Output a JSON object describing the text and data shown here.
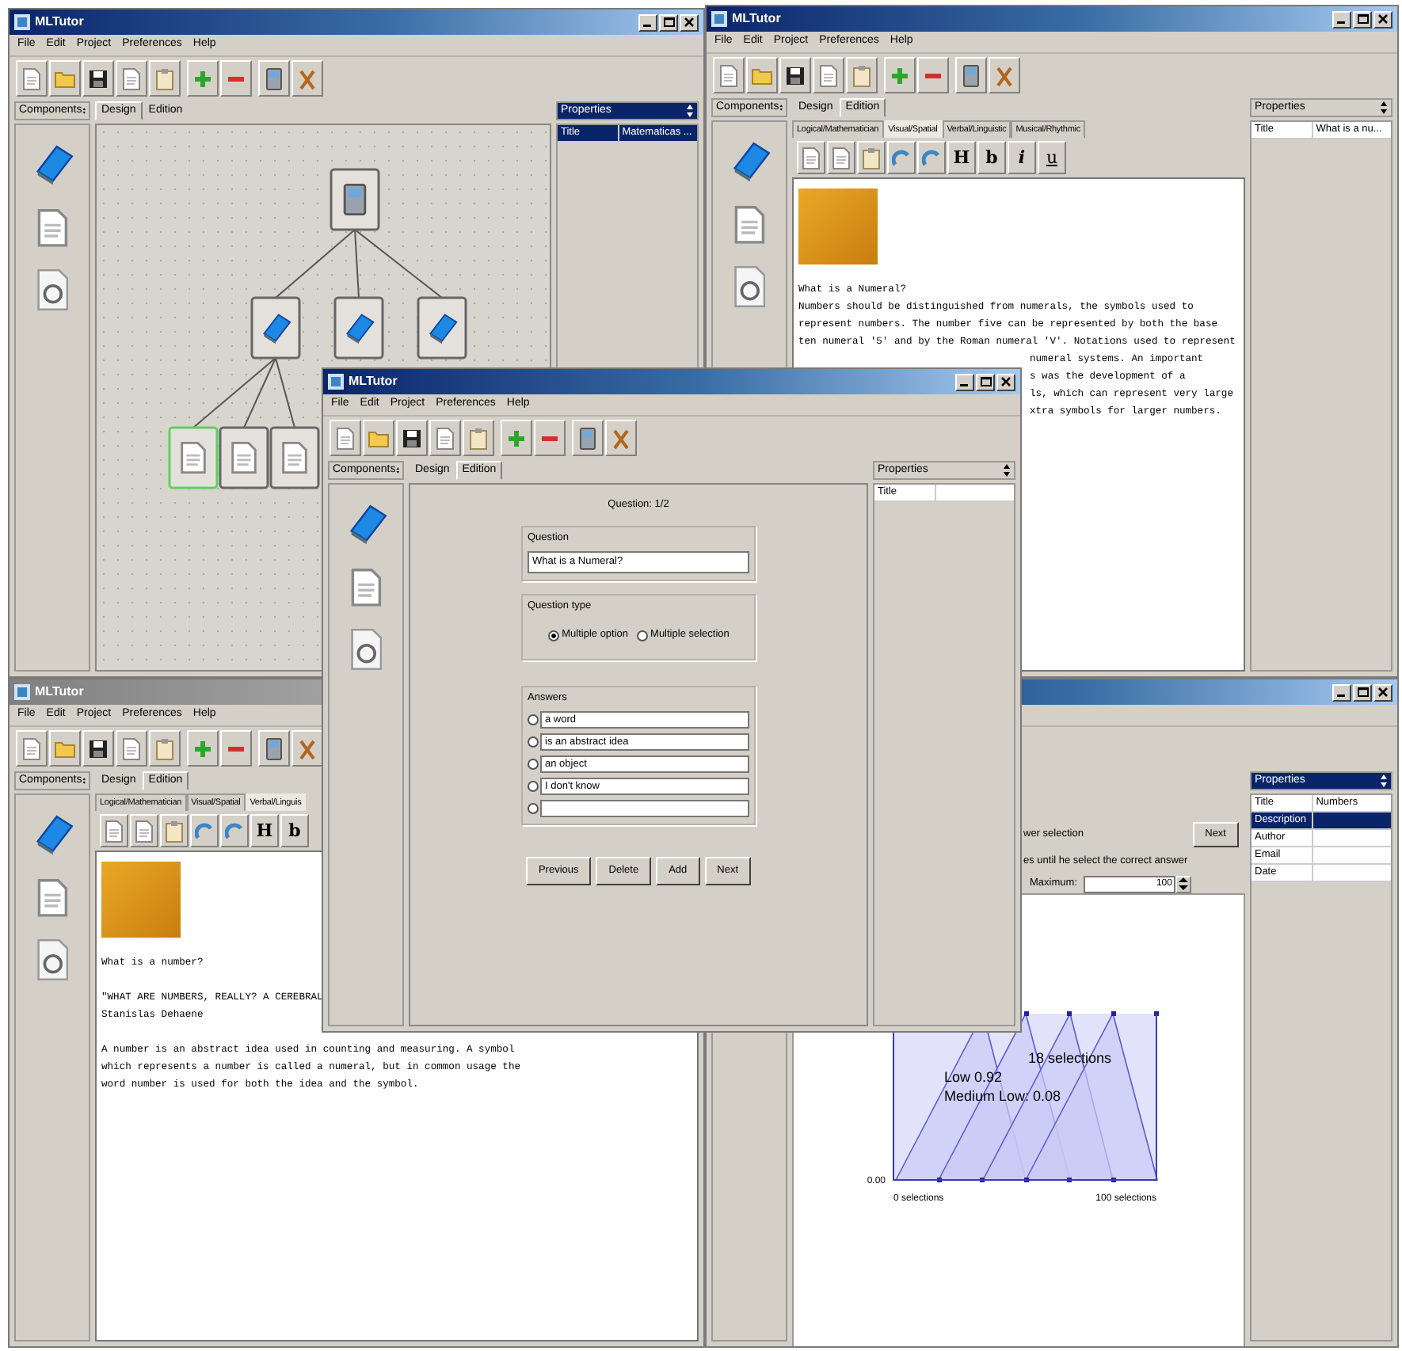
{
  "windows": [
    {
      "kind": "design",
      "active": true,
      "title": "MLTutor",
      "window_buttons": true,
      "menu": [
        "File",
        "Edit",
        "Project",
        "Preferences",
        "Help"
      ],
      "toolbar": true,
      "components_header": "Components",
      "component_icons": true,
      "tabs": [
        {
          "label": "Design",
          "selected": true
        },
        {
          "label": "Edition",
          "selected": false
        }
      ],
      "tree": {
        "kind": "device",
        "selected": false,
        "children": [
          {
            "kind": "book",
            "selected": false,
            "children": [
              {
                "kind": "document",
                "selected": true
              },
              {
                "kind": "document",
                "selected": false
              },
              {
                "kind": "document",
                "selected": false
              }
            ]
          },
          {
            "kind": "book",
            "selected": false
          },
          {
            "kind": "book",
            "selected": false
          }
        ]
      },
      "properties": {
        "header": "Properties",
        "header_active": true,
        "rows": [
          {
            "name": "Title",
            "value": "Matematicas ...",
            "selected": true
          }
        ]
      }
    },
    {
      "kind": "edition",
      "active": true,
      "title": "MLTutor",
      "window_buttons": true,
      "menu": [
        "File",
        "Edit",
        "Project",
        "Preferences",
        "Help"
      ],
      "toolbar": true,
      "components_header": "Components",
      "component_icons": true,
      "tabs": [
        {
          "label": "Design",
          "selected": false
        },
        {
          "label": "Edition",
          "selected": true
        }
      ],
      "subtabs": [
        {
          "label": "Logical/Mathematician",
          "selected": false
        },
        {
          "label": "Visual/Spatial",
          "selected": true
        },
        {
          "label": "Verbal/Linguistic",
          "selected": false
        },
        {
          "label": "Musical/Rhythmic",
          "selected": false
        }
      ],
      "format_buttons": [
        {
          "label": "H",
          "kind": "heading"
        },
        {
          "label": "b",
          "kind": "bold"
        },
        {
          "label": "i",
          "kind": "italic"
        },
        {
          "label": "u",
          "kind": "underline"
        }
      ],
      "picture": true,
      "blocks": [
        {
          "kind": "line",
          "text": "What is a Numeral?"
        },
        {
          "kind": "line",
          "text": "Numbers should be distinguished from numerals, the symbols used to\nrepresent numbers. The number five can be represented by both the base\nten numeral '5' and by the Roman numeral 'V'. Notations used to represent"
        },
        {
          "kind": "partial",
          "text": "numeral systems. An important"
        },
        {
          "kind": "partial",
          "text": "s was the development of a"
        },
        {
          "kind": "partial",
          "text": "ls, which can represent very large"
        },
        {
          "kind": "partial",
          "text": "xtra symbols for larger numbers."
        }
      ],
      "properties": {
        "header": "Properties",
        "header_active": false,
        "rows": [
          {
            "name": "Title",
            "value": "What is a nu...",
            "selected": false
          }
        ]
      }
    },
    {
      "kind": "edition",
      "active": false,
      "title": "MLTutor",
      "menu": [
        "File",
        "Edit",
        "Project",
        "Preferences",
        "Help"
      ],
      "toolbar": true,
      "components_header": "Components",
      "component_icons": true,
      "tabs": [
        {
          "label": "Design",
          "selected": false
        },
        {
          "label": "Edition",
          "selected": true
        }
      ],
      "subtabs": [
        {
          "label": "Logical/Mathematician",
          "selected": false
        },
        {
          "label": "Visual/Spatial",
          "selected": false
        },
        {
          "label": "Verbal/Linguis",
          "selected": true
        }
      ],
      "format_buttons": [
        {
          "label": "H",
          "kind": "heading"
        },
        {
          "label": "b",
          "kind": "bold"
        }
      ],
      "picture": true,
      "blocks": [
        {
          "kind": "line",
          "text": "What is a number?"
        },
        {
          "kind": "paragraph",
          "text": "\"WHAT ARE NUMBERS, REALLY? A CEREBRAL\nStanislas Dehaene"
        },
        {
          "kind": "paragraph",
          "text": "A number is an abstract idea used in counting and measuring. A symbol\nwhich represents a number is called a numeral, but in common usage the\nword number is used for both the idea and the symbol."
        }
      ]
    },
    {
      "kind": "chart",
      "active": true,
      "window_buttons": true,
      "component_icons": false,
      "options": {
        "text1": "wer selection",
        "button": "Next",
        "text2": "es until he select the correct answer",
        "max_label": "Maximum:",
        "max_value": "100"
      },
      "chart": {
        "y_label": "0.00",
        "x_start": "0 selections",
        "x_end": "100 selections",
        "annotations": [
          "18 selections",
          "Low 0.92",
          "Medium Low: 0.08"
        ]
      },
      "properties": {
        "header": "Properties",
        "header_active": true,
        "rows": [
          {
            "name": "Title",
            "value": "Numbers",
            "selected": false
          },
          {
            "name": "Description",
            "selected": true
          },
          {
            "name": "Author",
            "selected": false
          },
          {
            "name": "Email",
            "selected": false
          },
          {
            "name": "Date",
            "selected": false
          }
        ]
      }
    },
    {
      "kind": "question",
      "active": true,
      "title": "MLTutor",
      "window_buttons": true,
      "menu": [
        "File",
        "Edit",
        "Project",
        "Preferences",
        "Help"
      ],
      "toolbar": true,
      "components_header": "Components",
      "component_icons": true,
      "tabs": [
        {
          "label": "Design",
          "selected": false
        },
        {
          "label": "Edition",
          "selected": true
        }
      ],
      "question": {
        "counter": "Question: 1/2",
        "question_label": "Question",
        "question_value": "What is a Numeral?",
        "type_label": "Question type",
        "types": [
          {
            "label": "Multiple option",
            "selected": true
          },
          {
            "label": "Multiple selection",
            "selected": false
          }
        ],
        "answers_label": "Answers",
        "answers": [
          {
            "text": "a word",
            "selected": false
          },
          {
            "text": "is an abstract idea",
            "selected": false
          },
          {
            "text": "an object",
            "selected": false
          },
          {
            "text": "I don't know",
            "selected": false
          },
          {
            "selected": false
          }
        ],
        "buttons": [
          "Previous",
          "Delete",
          "Add",
          "Next"
        ]
      },
      "properties": {
        "header": "Properties",
        "header_active": false,
        "rows": [
          {
            "name": "Title",
            "selected": false
          }
        ]
      }
    }
  ]
}
